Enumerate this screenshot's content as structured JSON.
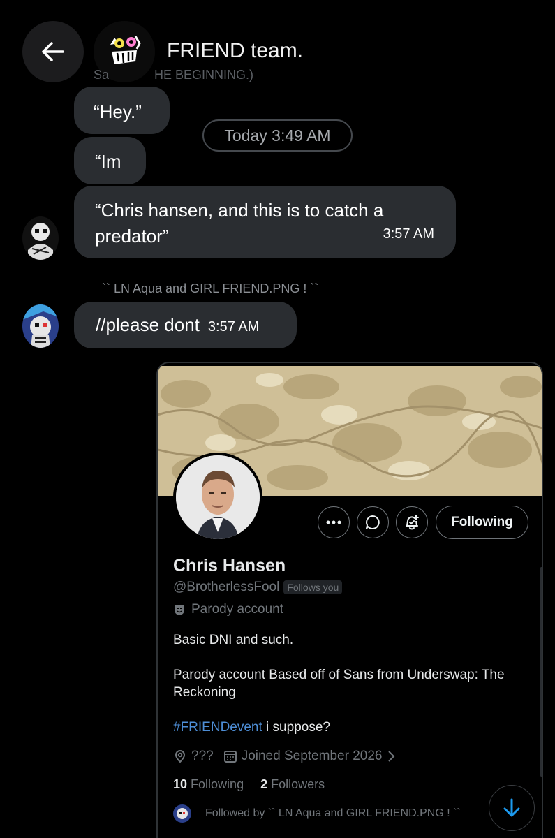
{
  "header": {
    "title": "FRIEND team.",
    "faded_sender": "Sa",
    "faded_sender_tail": "HE BEGINNING.)"
  },
  "messages": [
    {
      "text": "“Hey.”"
    },
    {
      "text": "“Im"
    },
    {
      "text": "“Chris hansen, and this is to catch a predator”",
      "time": "3:57 AM"
    },
    {
      "text": "//please dont",
      "time": "3:57 AM"
    }
  ],
  "date_separator": "Today 3:49 AM",
  "second_sender_name": "`` LN Aqua and GIRL FRIEND.PNG ! ``",
  "profile": {
    "name": "Chris Hansen",
    "handle": "@BrotherlessFool",
    "follows_you": "Follows you",
    "parody_label": "Parody account",
    "bio_line1": "Basic DNI and such.",
    "bio_line2": "Parody account Based off of Sans from Underswap: The Reckoning",
    "hashtag": "#FRIENDevent",
    "bio_line3_rest": " i suppose?",
    "location": "???",
    "joined": "Joined September 2026",
    "following_count": "10",
    "following_label": "Following",
    "followers_count": "2",
    "followers_label": "Followers",
    "followed_by": "Followed by `` LN Aqua and GIRL FRIEND.PNG ! ``",
    "follow_button": "Following"
  },
  "colors": {
    "bubble": "#2a2d31",
    "link": "#4e8ed6",
    "muted": "#71767b",
    "scroll_arrow": "#1d9bf0"
  }
}
